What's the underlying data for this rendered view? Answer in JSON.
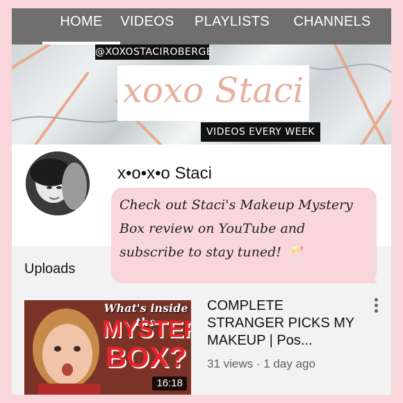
{
  "tabs": [
    {
      "label": "HOME",
      "active": true
    },
    {
      "label": "VIDEOS"
    },
    {
      "label": "PLAYLISTS"
    },
    {
      "label": "CHANNELS"
    }
  ],
  "banner": {
    "handle": "@XOXOSTACIROBERGE",
    "title": "xoxo Staci",
    "tagline": "VIDEOS EVERY WEEK"
  },
  "channel": {
    "name": "x•o•x•o Staci"
  },
  "uploads": {
    "heading": "Uploads",
    "videos": [
      {
        "title": "COMPLETE STRANGER PICKS MY MAKEUP | Pos...",
        "meta": "31 views · 1 day ago",
        "duration": "16:18",
        "thumb_question": "What's inside the",
        "thumb_mystery": "MYSTERY",
        "thumb_box": "BOX?"
      }
    ]
  },
  "caption": {
    "text": "Check out Staci's Makeup Mystery Box review on YouTube and subscribe to stay tuned! 🥂"
  },
  "colors": {
    "page_background": "#f9d6d9",
    "tab_bar": "#6f6f6f",
    "uploads_background": "#f2f2f2",
    "caption_bubble": "#f9d6d9",
    "thumb_text_red": "#e6232a",
    "banner_rose_gold": "#e6b29f"
  },
  "icons": {
    "more": "vertical-ellipsis-icon"
  }
}
